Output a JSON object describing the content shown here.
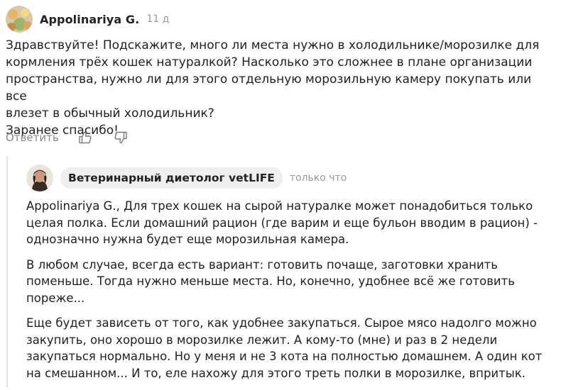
{
  "comment": {
    "author": "Appolinariya G.",
    "time": "11 д",
    "lines": [
      "Здравствуйте! Подскажите, много ли места нужно в холодильнике/морозилке для",
      "кормления трёх кошек натуралкой? Насколько это сложнее в плане организации",
      "пространства, нужно ли для этого отдельную морозильную камеру покупать или все",
      "влезет в обычный холодильник?",
      "Заранее спасибо!"
    ],
    "reply_label": "Ответить",
    "like_icon": "thumbs-up-icon",
    "dislike_icon": "thumbs-down-icon"
  },
  "reply": {
    "author": "Ветеринарный диетолог vetLIFE",
    "time": "только что",
    "paragraphs": [
      [
        "Appolinariya G., Для трех кошек на сырой натуралке может понадобиться только",
        "целая полка. Если домашний рацион (где варим и еще бульон вводим в рацион) -",
        "однозначно нужна будет еще морозильная камера."
      ],
      [
        "В любом случае, всегда есть вариант: готовить почаще, заготовки хранить",
        "поменьше. Тогда нужно меньше места. Но, конечно, удобнее всё же готовить",
        "пореже..."
      ],
      [
        "Еще будет зависеть от того, как удобнее закупаться. Сырое мясо надолго можно",
        "закупить, оно хорошо в морозилке лежит. А кому-то (мне) и раз в 2 недели",
        "закупаться нормально. Но у меня и не 3 кота на полностью домашнем. А один кот",
        "на смешанном... И то, еле нахожу для этого треть полки в морозилке, впритык."
      ]
    ]
  },
  "colors": {
    "muted": "#8a8a8a",
    "pill_bg": "#efefef",
    "thread_line": "#e3e3e3"
  }
}
